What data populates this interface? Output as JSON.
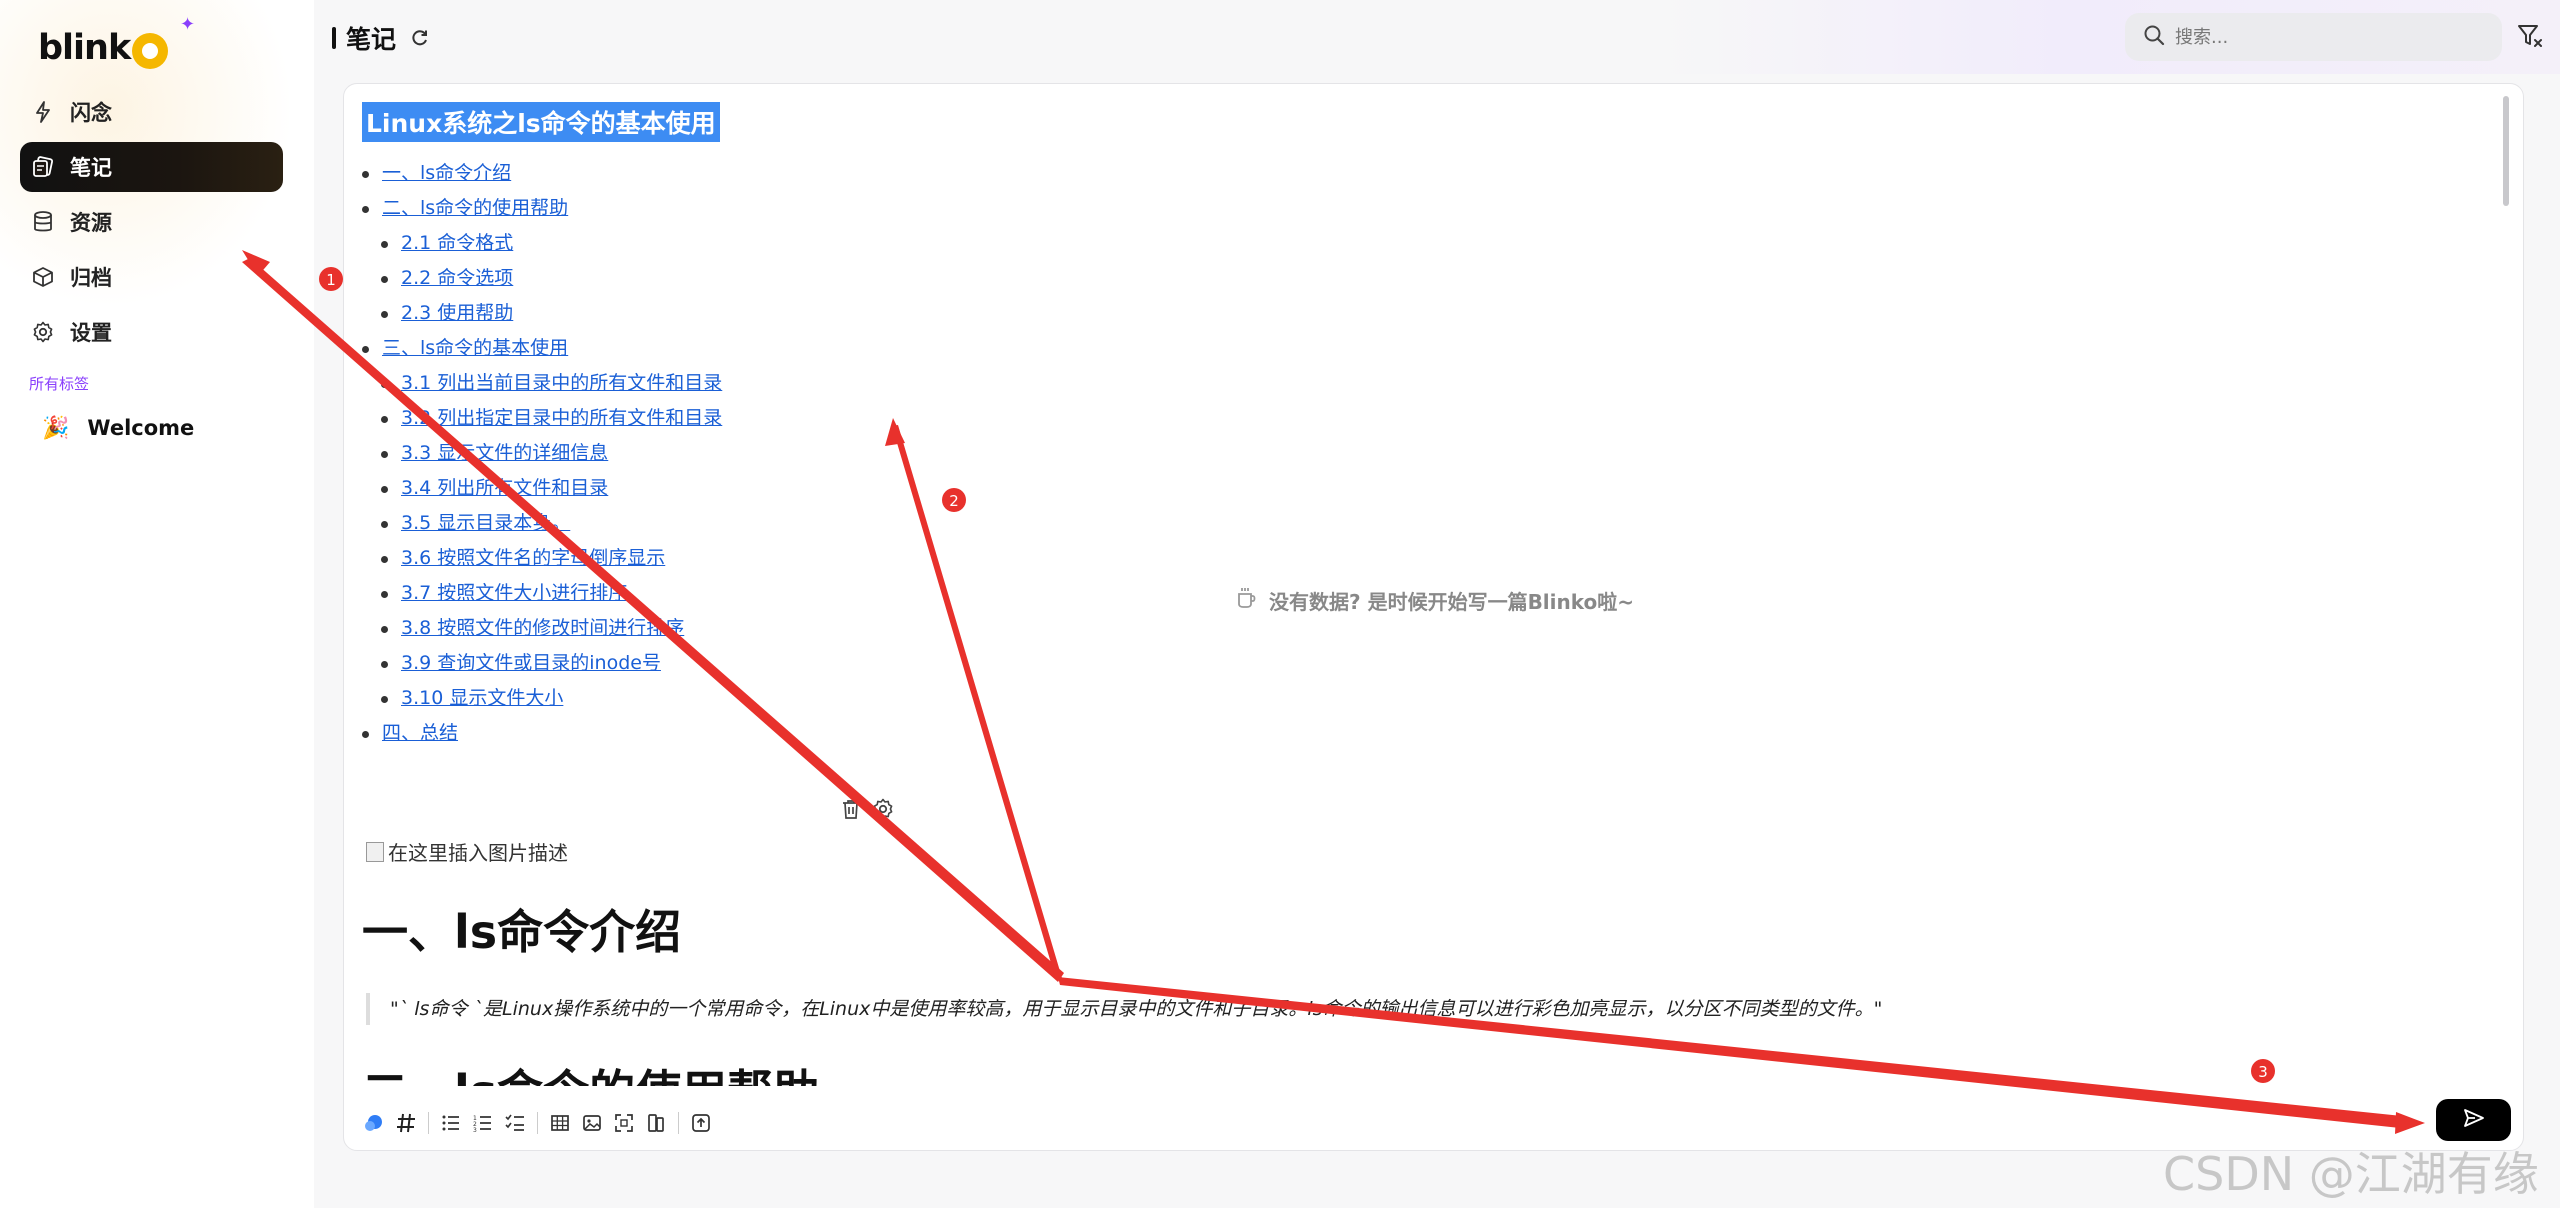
{
  "sidebar": {
    "logo_text": "blink",
    "nav": [
      {
        "label": "闪念",
        "icon": "lightning-icon",
        "active": false
      },
      {
        "label": "笔记",
        "icon": "notes-icon",
        "active": true
      },
      {
        "label": "资源",
        "icon": "database-icon",
        "active": false
      },
      {
        "label": "归档",
        "icon": "archive-box-icon",
        "active": false
      },
      {
        "label": "设置",
        "icon": "gear-icon",
        "active": false
      }
    ],
    "tags_title": "所有标签",
    "tags": [
      {
        "label": "Welcome",
        "icon": "party-popper-icon"
      }
    ]
  },
  "header": {
    "title": "笔记",
    "search_placeholder": "搜索..."
  },
  "editor": {
    "doc_title": "Linux系统之ls命令的基本使用",
    "toc": [
      {
        "text": "一、ls命令介绍",
        "level": 1
      },
      {
        "text": "二、ls命令的使用帮助",
        "level": 1
      },
      {
        "text": "2.1 命令格式",
        "level": 2
      },
      {
        "text": "2.2 命令选项",
        "level": 2
      },
      {
        "text": "2.3 使用帮助",
        "level": 2
      },
      {
        "text": "三、ls命令的基本使用",
        "level": 1
      },
      {
        "text": "3.1 列出当前目录中的所有文件和目录",
        "level": 2
      },
      {
        "text": "3.2 列出指定目录中的所有文件和目录",
        "level": 2
      },
      {
        "text": "3.3 显示文件的详细信息",
        "level": 2
      },
      {
        "text": "3.4 列出所有文件和目录",
        "level": 2
      },
      {
        "text": "3.5 显示目录本身。",
        "level": 2
      },
      {
        "text": "3.6 按照文件名的字母倒序显示",
        "level": 2
      },
      {
        "text": "3.7 按照文件大小进行排序",
        "level": 2
      },
      {
        "text": "3.8 按照文件的修改时间进行排序",
        "level": 2
      },
      {
        "text": "3.9 查询文件或目录的inode号",
        "level": 2
      },
      {
        "text": "3.10 显示文件大小",
        "level": 2
      },
      {
        "text": "四、总结",
        "level": 1
      }
    ],
    "image_alt": "在这里插入图片描述",
    "heading1": "一、ls命令介绍",
    "quote": "\"` ls命令 `是Linux操作系统中的一个常用命令，在Linux中是使用率较高，用于显示目录中的文件和子目录。ls命令的输出信息可以进行彩色加亮显示，以分区不同类型的文件。\"",
    "heading2": "二、ls命令的使用帮助",
    "empty_tip": "没有数据? 是时候开始写一篇Blinko啦~"
  },
  "annotations": {
    "markers": [
      "1",
      "2",
      "3"
    ],
    "watermark": "CSDN @江湖有缘",
    "color": "#e8312c"
  },
  "colors": {
    "accent_purple": "#8a3ffc",
    "selection_blue": "#3d8cf3",
    "link_blue": "#1a5fd6",
    "logo_yellow": "#f5b700"
  }
}
